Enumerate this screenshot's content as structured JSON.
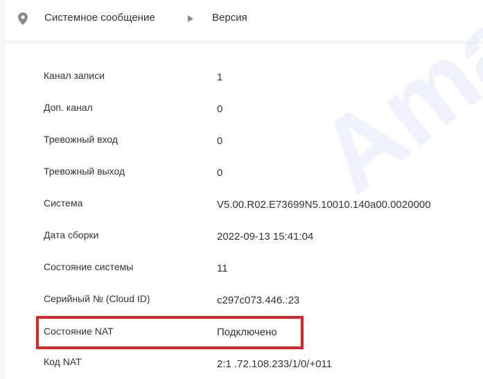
{
  "breadcrumb": {
    "icon": "location-pin-icon",
    "section": "Системное сообщение",
    "separator_icon": "triangle-right-icon",
    "page": "Версия"
  },
  "watermark": "Ama",
  "info_rows": [
    {
      "label": "Канал записи",
      "value": "1"
    },
    {
      "label": "Доп. канал",
      "value": "0"
    },
    {
      "label": "Тревожный вход",
      "value": "0"
    },
    {
      "label": "Тревожный выход",
      "value": "0"
    },
    {
      "label": "Система",
      "value": "V5.00.R02.E73699N5.10010.140a00.0020000"
    },
    {
      "label": "Дата сборки",
      "value": "2022-09-13 15:41:04"
    },
    {
      "label": "Состояние системы",
      "value": "11"
    },
    {
      "label": "Серийный № (Cloud ID)",
      "value": "c297c073.446.:23"
    },
    {
      "label": "Состояние NAT",
      "value": "Подключено"
    },
    {
      "label": "Код NAT",
      "value": "2:1   .72.108.233/1/0/+011"
    }
  ],
  "colors": {
    "highlight": "#e02424",
    "text": "#333333",
    "icon": "#8a8a8a"
  }
}
